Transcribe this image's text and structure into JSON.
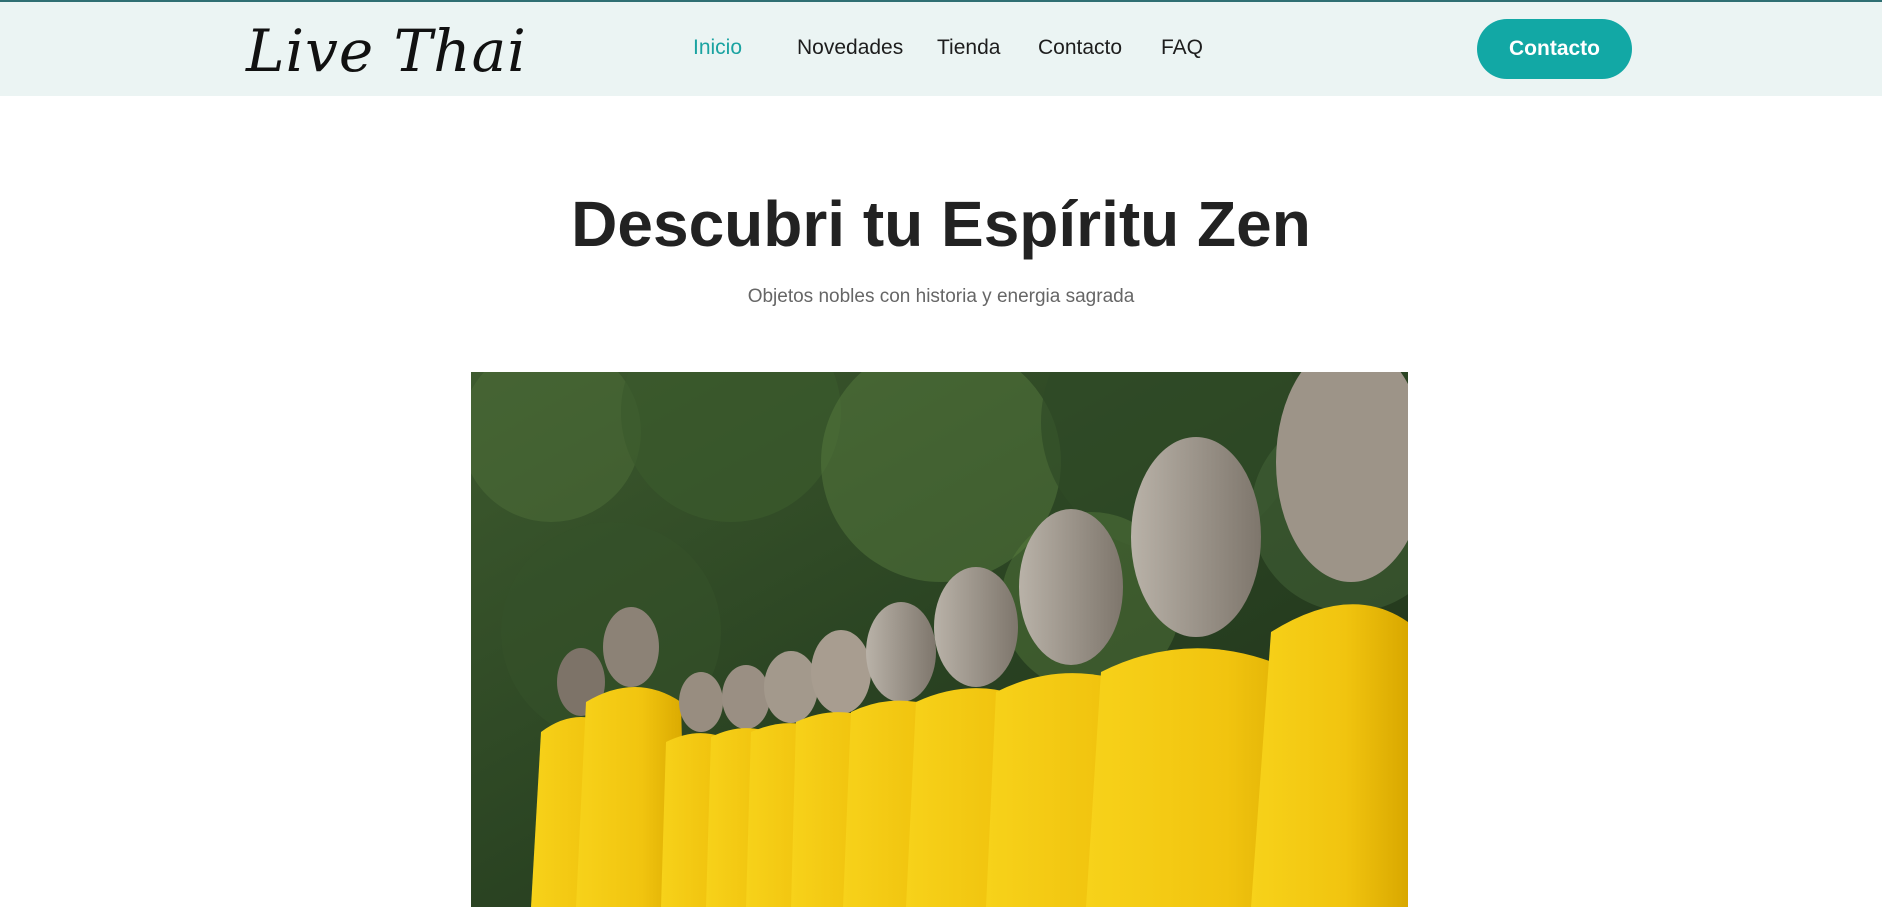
{
  "logo": {
    "text": "Live Thai"
  },
  "nav": {
    "items": [
      {
        "label": "Inicio",
        "active": true
      },
      {
        "label": "Novedades",
        "active": false
      },
      {
        "label": "Tienda",
        "active": false
      },
      {
        "label": "Contacto",
        "active": false
      },
      {
        "label": "FAQ",
        "active": false
      }
    ]
  },
  "cta": {
    "label": "Contacto"
  },
  "hero": {
    "title": "Descubri tu Espíritu Zen",
    "subtitle": "Objetos nobles con historia y energia sagrada"
  },
  "colors": {
    "accent": "#12a8a5",
    "header_bg": "#ebf4f3",
    "robe": "#f1c40f"
  }
}
